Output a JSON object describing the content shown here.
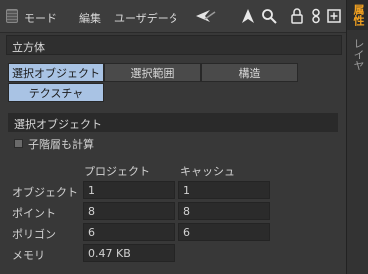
{
  "menu": {
    "mode": "モード",
    "edit": "編集",
    "user_data": "ユーザデータ"
  },
  "toolbar": {
    "icons": [
      "back-arrow-icon",
      "pointer-icon",
      "search-icon",
      "lock-icon",
      "link-icon",
      "new-window-icon"
    ]
  },
  "side_tabs": {
    "attributes": "属性",
    "layers": "レイヤ"
  },
  "title": "立方体",
  "tabs": {
    "selection_object": "選択オブジェクト",
    "selection_range": "選択範囲",
    "structure": "構造",
    "texture": "テクスチャ"
  },
  "section": {
    "title": "選択オブジェクト",
    "checkbox_label": "子階層も計算"
  },
  "columns": {
    "project": "プロジェクト",
    "cache": "キャッシュ"
  },
  "rows": [
    {
      "label": "オブジェクト",
      "project": "1",
      "cache": "1"
    },
    {
      "label": "ポイント",
      "project": "8",
      "cache": "8"
    },
    {
      "label": "ポリゴン",
      "project": "6",
      "cache": "6"
    },
    {
      "label": "メモリ",
      "project": "0.47 KB"
    }
  ],
  "colors": {
    "accent_tab": "#f0a020",
    "active_tab": "#a9c3e4"
  }
}
